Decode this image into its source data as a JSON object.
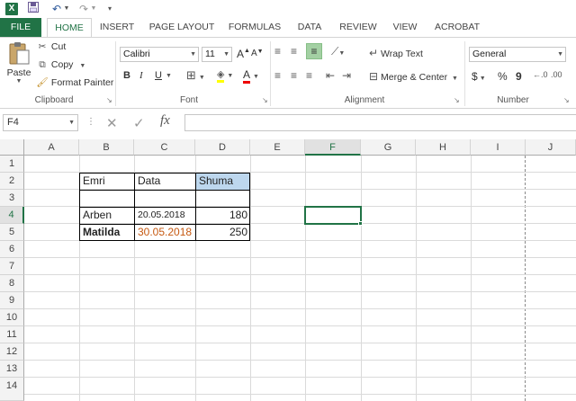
{
  "title_bar": {
    "excel_logo": "X",
    "save_icon": "save-icon",
    "undo_icon": "undo-icon",
    "redo_icon": "redo-icon",
    "customize_icon": "customize-qat-icon"
  },
  "tabs": [
    {
      "label": "FILE"
    },
    {
      "label": "HOME"
    },
    {
      "label": "INSERT"
    },
    {
      "label": "PAGE LAYOUT"
    },
    {
      "label": "FORMULAS"
    },
    {
      "label": "DATA"
    },
    {
      "label": "REVIEW"
    },
    {
      "label": "VIEW"
    },
    {
      "label": "ACROBAT"
    }
  ],
  "ribbon": {
    "clipboard": {
      "label": "Clipboard",
      "paste": "Paste",
      "cut": "Cut",
      "copy": "Copy",
      "format_painter": "Format Painter"
    },
    "font": {
      "label": "Font",
      "font_name": "Calibri",
      "font_size": "11",
      "bold": "B",
      "italic": "I",
      "underline": "U",
      "grow": "A",
      "shrink": "A"
    },
    "alignment": {
      "label": "Alignment",
      "wrap_text": "Wrap Text",
      "merge_center": "Merge & Center"
    },
    "number": {
      "label": "Number",
      "format": "General",
      "currency": "$",
      "percent": "%",
      "comma": "9"
    }
  },
  "formula_bar": {
    "name_box": "F4",
    "fx": "fx",
    "cancel": "✕",
    "enter": "✓",
    "content": ""
  },
  "sheet": {
    "columns": [
      "A",
      "B",
      "C",
      "D",
      "E",
      "F",
      "G",
      "H",
      "I",
      "J"
    ],
    "rows": [
      "1",
      "2",
      "3",
      "4",
      "5",
      "6",
      "7",
      "8",
      "9",
      "10",
      "11",
      "12",
      "13",
      "14"
    ],
    "selected_cell": "F4",
    "cells": {
      "B2": "Emri",
      "C2": "Data",
      "D2": "Shuma",
      "B4": "Arben",
      "C4": "20.05.2018",
      "D4": "180",
      "B5": "Matilda",
      "C5": "30.05.2018",
      "D5": "250"
    },
    "colors": {
      "accent": "#217346",
      "header_fill": "#bdd7ee",
      "date_orange": "#c65911"
    }
  }
}
